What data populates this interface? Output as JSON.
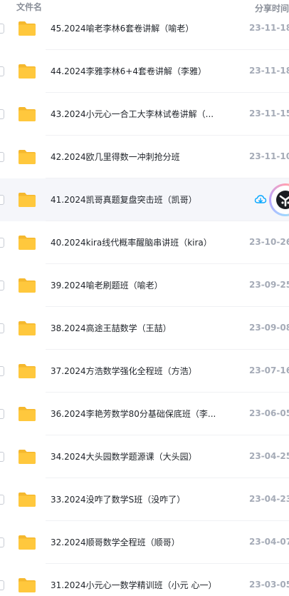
{
  "header": {
    "name_col": "文件名",
    "date_col": "分享时间"
  },
  "rows": [
    {
      "name": "45.2024喻老李林6套卷讲解（喻老）",
      "date": "23-11-18"
    },
    {
      "name": "44.2024李雅李林6+4套卷讲解（李雅）",
      "date": "23-11-18"
    },
    {
      "name": "43.2024小元心一合工大李林试卷讲解（...",
      "date": "23-11-15"
    },
    {
      "name": "42.2024欧几里得数一冲刺抢分班",
      "date": "23-11-10"
    },
    {
      "name": "41.2024凯哥真题复盘突击班（凯哥）",
      "date": "",
      "hover": true
    },
    {
      "name": "40.2024kira线代概率醒脑串讲班（kira）",
      "date": "23-10-26"
    },
    {
      "name": "39.2024喻老刷题班（喻老）",
      "date": "23-09-25"
    },
    {
      "name": "38.2024高途王喆数学（王喆）",
      "date": "23-09-08"
    },
    {
      "name": "37.2024方浩数学强化全程班（方浩）",
      "date": "23-07-16"
    },
    {
      "name": "36.2024李艳芳数学80分基础保底班（李...",
      "date": "23-06-05"
    },
    {
      "name": "34.2024大头园数学题源课（大头园）",
      "date": "23-04-25"
    },
    {
      "name": "33.2024没咋了数学S班（没咋了）",
      "date": "23-04-23"
    },
    {
      "name": "32.2024顺哥数学全程班（顺哥）",
      "date": "23-04-07"
    },
    {
      "name": "31.2024小元心一数学精训班（小元 心一）",
      "date": "23-03-05"
    }
  ],
  "icons": {
    "folder": "folder-icon",
    "download": "cloud-download-icon",
    "avatar": "assistant-avatar"
  },
  "colors": {
    "folder": "#ffc83d",
    "folder_dark": "#f5b82e",
    "accent": "#06a7ff",
    "date": "#a5abb7"
  }
}
